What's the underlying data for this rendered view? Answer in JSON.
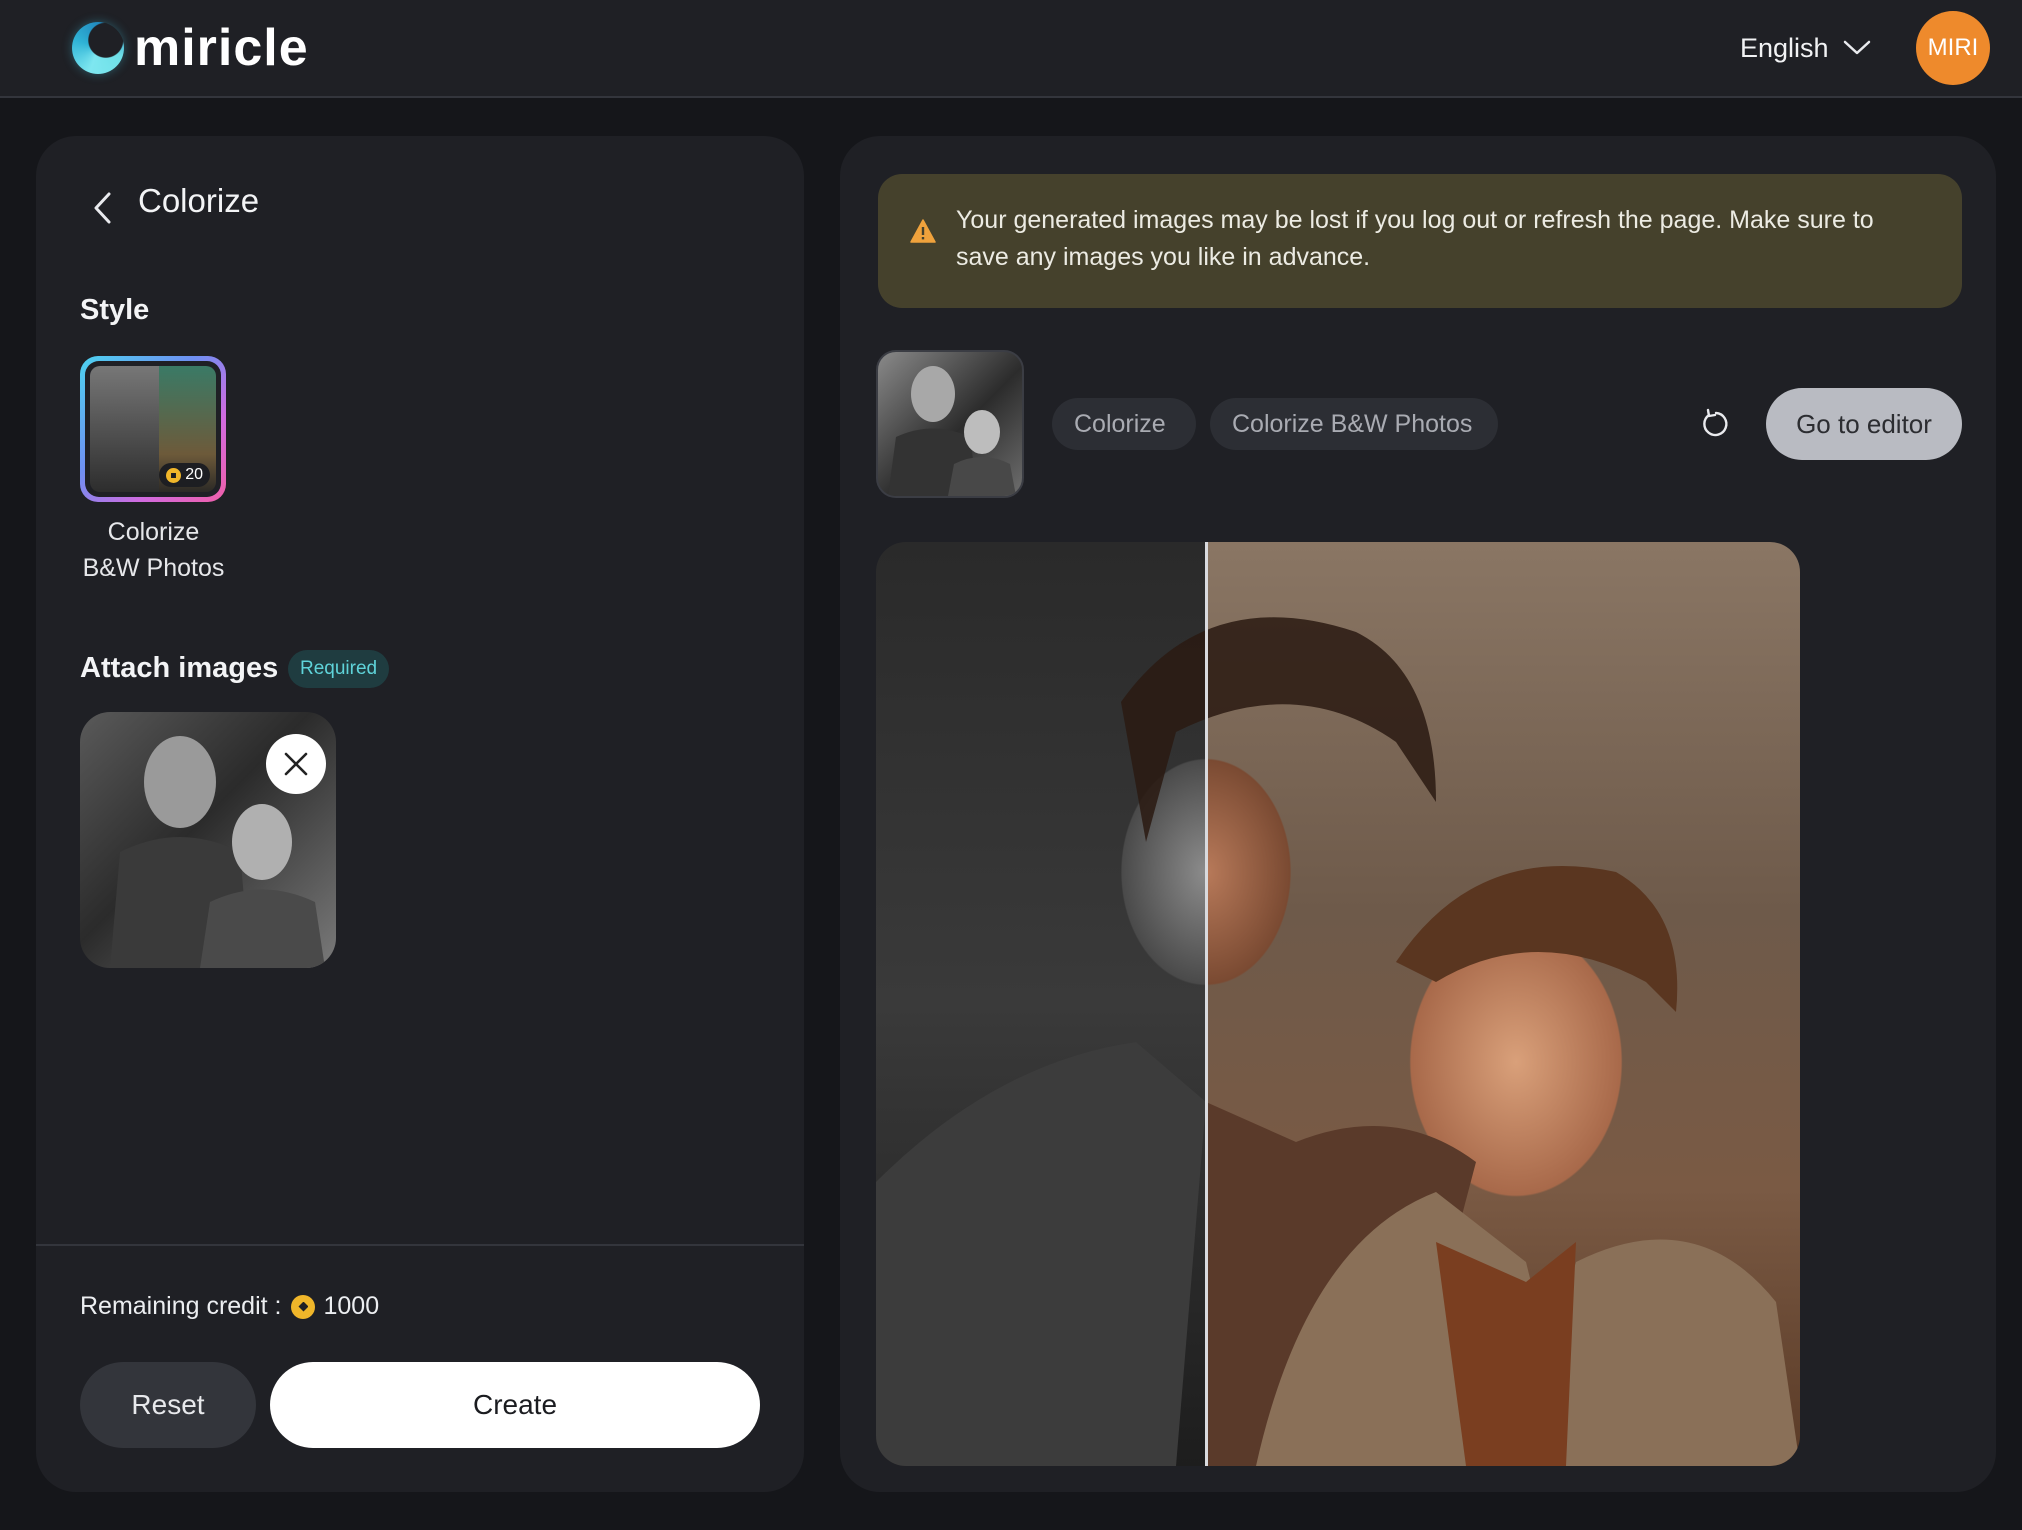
{
  "app": {
    "name": "miricle",
    "language": "English",
    "user_initials": "MIRI"
  },
  "left_panel": {
    "title": "Colorize",
    "style_section_label": "Style",
    "style_option": {
      "credit_cost": "20",
      "caption_line1": "Colorize",
      "caption_line2": "B&W Photos"
    },
    "attach_section_label": "Attach images",
    "required_badge": "Required",
    "remaining_credit_label": "Remaining credit :",
    "remaining_credit_value": "1000",
    "reset_label": "Reset",
    "create_label": "Create"
  },
  "right_panel": {
    "warning_text": "Your generated images may be lost if you log out or refresh the page. Make sure to save any images you like in advance.",
    "tags": [
      "Colorize",
      "Colorize B&W Photos"
    ],
    "go_to_editor_label": "Go to editor"
  },
  "colors": {
    "accent_orange": "#ee8a2c",
    "credit_coin": "#f0b62a",
    "required_teal": "#5fd3d9",
    "warning_bg": "#45412c",
    "warning_icon": "#f0a23c"
  }
}
